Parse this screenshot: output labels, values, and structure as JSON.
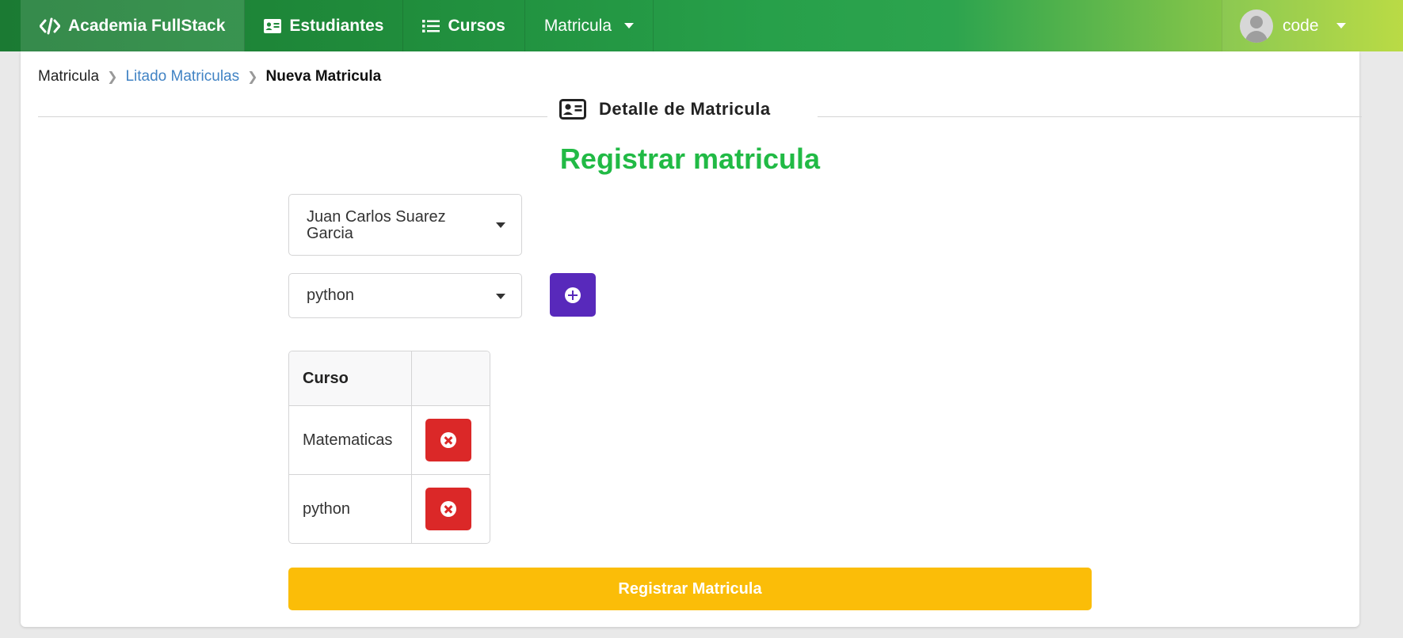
{
  "nav": {
    "brand": "Academia FullStack",
    "items": [
      {
        "label": "Estudiantes",
        "icon": "id-card-icon"
      },
      {
        "label": "Cursos",
        "icon": "list-icon"
      },
      {
        "label": "Matricula",
        "icon": "caret-down-icon"
      }
    ],
    "user": "code"
  },
  "breadcrumb": {
    "root": "Matricula",
    "link": "Litado Matriculas",
    "active": "Nueva Matricula"
  },
  "section_header": "Detalle de Matricula",
  "form": {
    "title": "Registrar matricula",
    "student_selected": "Juan Carlos Suarez Garcia",
    "course_selected": "python"
  },
  "table": {
    "header": "Curso",
    "rows": [
      "Matematicas",
      "python"
    ]
  },
  "submit_label": "Registrar Matricula",
  "colors": {
    "title_green": "#21ba45",
    "add_purple": "#5829bb",
    "delete_red": "#db2828",
    "submit_yellow": "#fbbd08",
    "link_blue": "#4183c4"
  }
}
